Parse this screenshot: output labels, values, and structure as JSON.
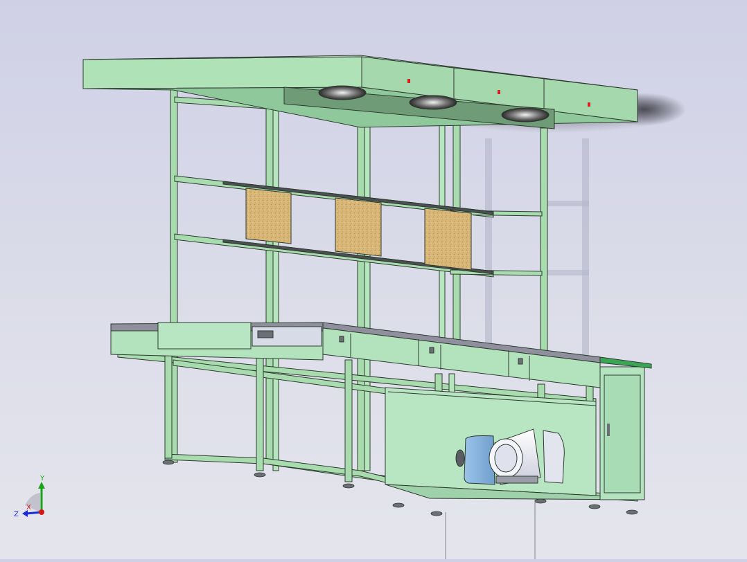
{
  "viewport": {
    "background_top": "#cfd0e6",
    "background_bottom": "#e4e5ec"
  },
  "model": {
    "frame_color": "#a8dcae",
    "frame_edge_color": "#2d3a2f",
    "panel_color": "#b2e3bd",
    "cork_color": "#d8b778",
    "work_surface_color": "#8f8f9e",
    "accent_strip_color": "#3aa655",
    "motor_color": "#e6e8f2",
    "pump_color": "#8fb8df"
  },
  "triad": {
    "y_label": "Y",
    "x_label": "X",
    "z_label": "Z",
    "y_color": "#1ca21c",
    "x_color": "#d01818",
    "z_color": "#1a2bd6"
  }
}
